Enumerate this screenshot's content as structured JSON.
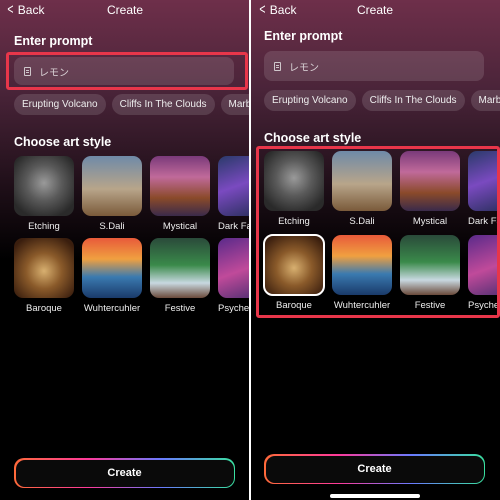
{
  "nav": {
    "back_label": "Back",
    "title": "Create"
  },
  "prompt": {
    "section_title": "Enter prompt",
    "value": "レモン"
  },
  "suggestions": [
    "Erupting Volcano",
    "Cliffs In The Clouds",
    "Marble"
  ],
  "styles": {
    "section_title": "Choose art style",
    "items": [
      "Etching",
      "S.Dali",
      "Mystical",
      "Dark Fantasy",
      "Baroque",
      "Wuhtercuhler",
      "Festive",
      "Psychedelic"
    ],
    "selected_right": "Baroque"
  },
  "create_label": "Create",
  "highlight_color": "#e8364a"
}
